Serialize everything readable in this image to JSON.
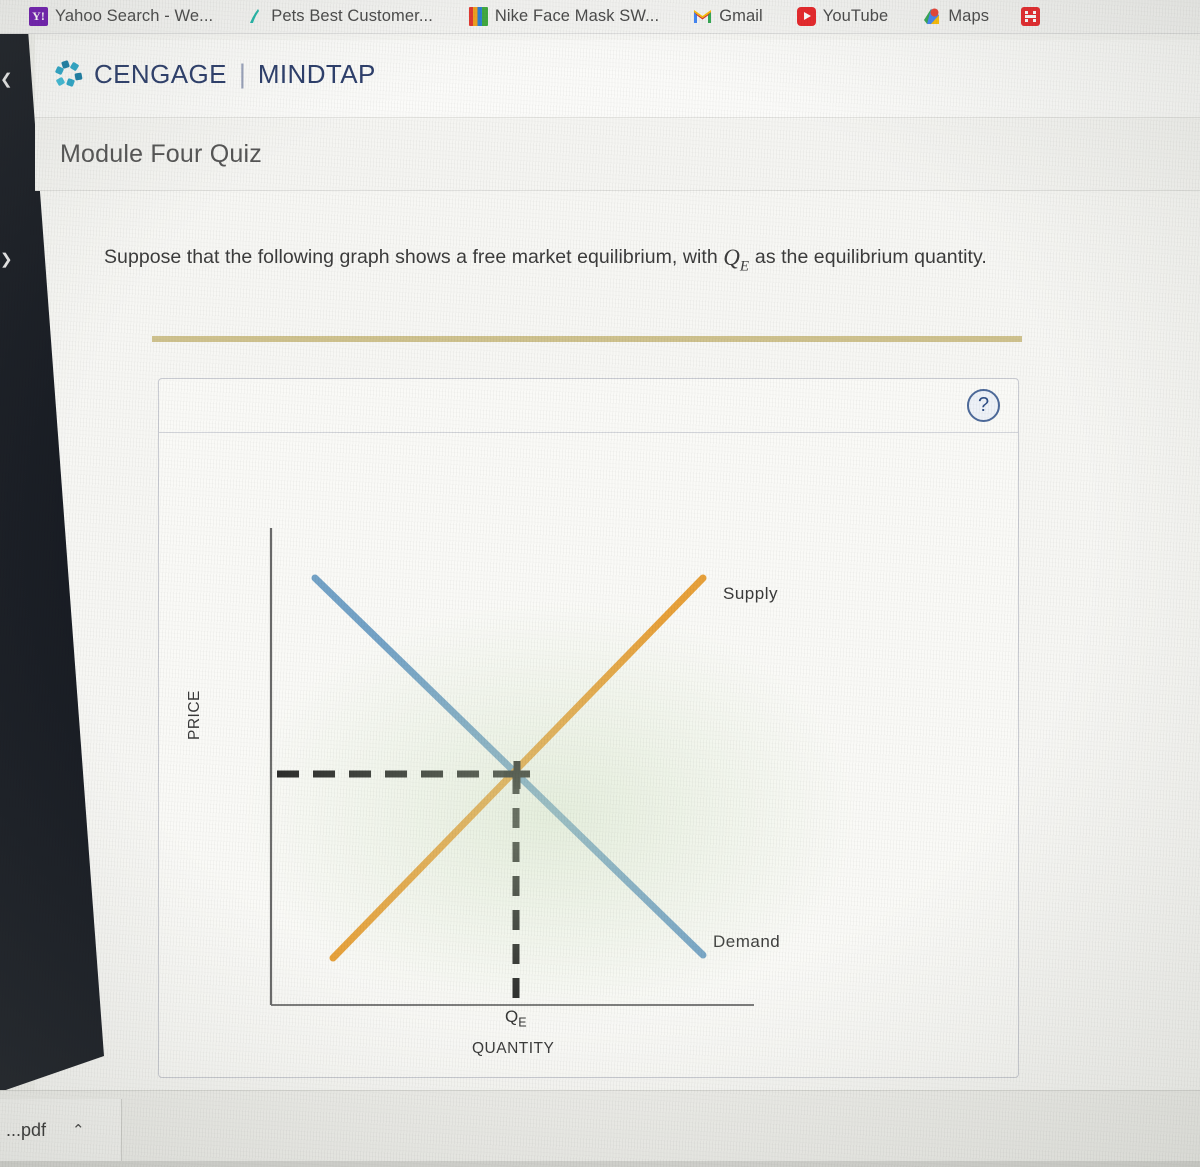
{
  "browser": {
    "bookmarks": [
      {
        "label": "Yahoo Search - We...",
        "icon": "yahoo-icon",
        "glyph": "Y!"
      },
      {
        "label": "Pets Best Customer...",
        "icon": "pets-icon",
        "glyph": "✓"
      },
      {
        "label": "Nike Face Mask SW...",
        "icon": "nike-icon",
        "glyph": ""
      },
      {
        "label": "Gmail",
        "icon": "gmail-icon",
        "glyph": "M"
      },
      {
        "label": "YouTube",
        "icon": "youtube-icon",
        "glyph": ""
      },
      {
        "label": "Maps",
        "icon": "maps-icon",
        "glyph": ""
      },
      {
        "label": "",
        "icon": "apps-grid-icon",
        "glyph": "☷"
      }
    ]
  },
  "brand": {
    "name": "CENGAGE",
    "divider": "|",
    "product": "MINDTAP"
  },
  "header": {
    "quiz_title": "Module Four Quiz"
  },
  "question": {
    "text_before": "Suppose that the following graph shows a free market equilibrium, with",
    "math_symbol": "Q",
    "math_subscript": "E",
    "text_after": "as the equilibrium quantity."
  },
  "figure": {
    "help_glyph": "?",
    "help_label": "Help"
  },
  "downloads": {
    "file_name": "...pdf",
    "caret": "⌃"
  },
  "colors": {
    "demand_line": "#74a3c7",
    "supply_line": "#e8a13a",
    "equilibrium_dash": "#262626",
    "axis": "#6a6a6a",
    "gold_rule": "#cfc28e",
    "brand_text": "#2c3e6b",
    "help_border": "#4d6a9a"
  },
  "chart_data": {
    "type": "line",
    "title": "",
    "xlabel": "QUANTITY",
    "ylabel": "PRICE",
    "grid": false,
    "legend": "inline-end-labels",
    "axis_ranges": {
      "x": [
        0,
        100
      ],
      "y": [
        0,
        100
      ]
    },
    "annotations": [
      {
        "name": "equilibrium-quantity-tick",
        "label": "Q",
        "subscript": "E",
        "x": 50,
        "y": 0
      },
      {
        "name": "equilibrium-price-dash",
        "label": "",
        "x": 0,
        "y": 50
      },
      {
        "name": "equilibrium-point-marker",
        "label": "+",
        "x": 50,
        "y": 50
      }
    ],
    "series": [
      {
        "name": "Demand",
        "color": "#74a3c7",
        "label_position": "right-lower",
        "points": [
          {
            "x": 11,
            "y": 91
          },
          {
            "x": 88,
            "y": 11
          }
        ]
      },
      {
        "name": "Supply",
        "color": "#e8a13a",
        "label_position": "right-upper",
        "points": [
          {
            "x": 11,
            "y": 10
          },
          {
            "x": 88,
            "y": 92
          }
        ]
      }
    ],
    "notes": "Downward-sloping blue Demand line crosses upward-sloping orange Supply line at the equilibrium point; dashed black lines drop to Q_E on the quantity axis and across to the equilibrium price on the price axis."
  }
}
